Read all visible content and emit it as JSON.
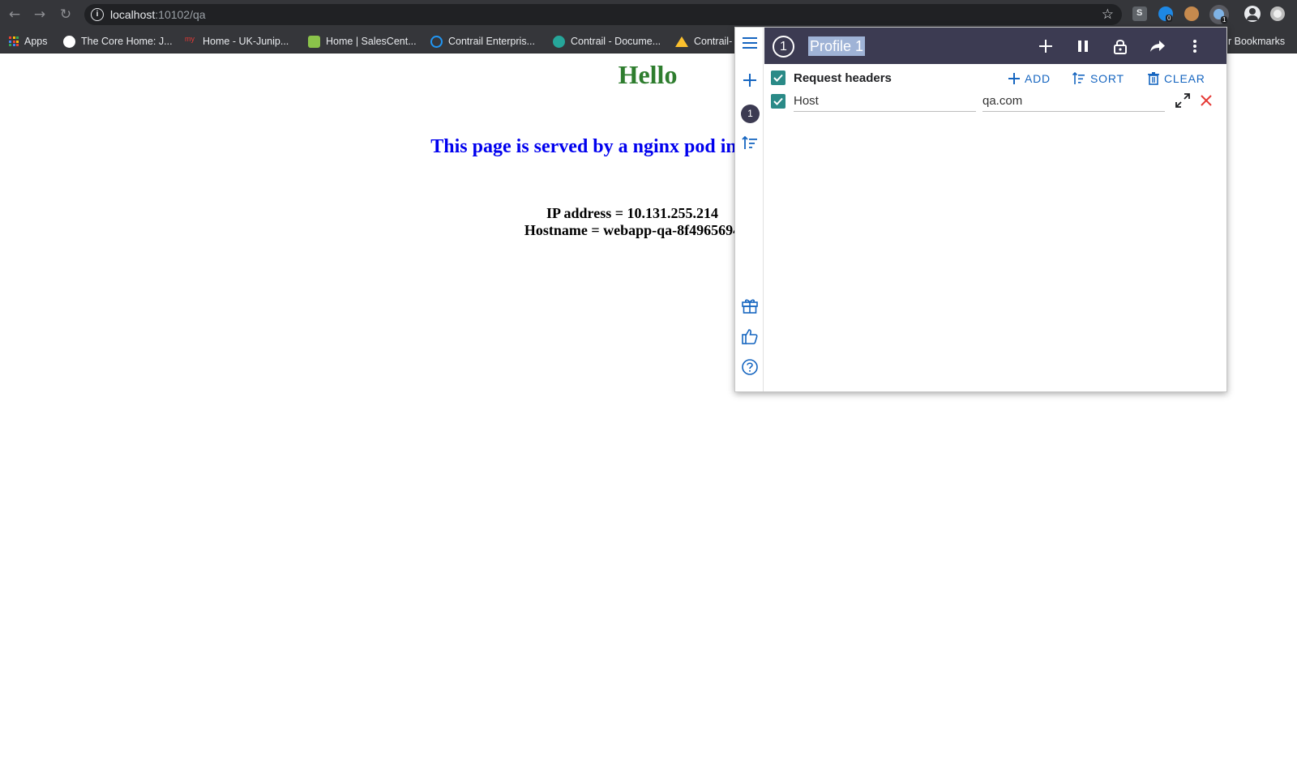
{
  "browser": {
    "url_host": "localhost",
    "url_path": ":10102/qa",
    "bookmarks": [
      {
        "label": "Apps",
        "color": "#e8eaed"
      },
      {
        "label": "The Core Home: J...",
        "color": "#ffffff"
      },
      {
        "label": "Home - UK-Junip...",
        "color": "#e53935"
      },
      {
        "label": "Home | SalesCent...",
        "color": "#8bc34a"
      },
      {
        "label": "Contrail Enterpris...",
        "color": "#2196f3"
      },
      {
        "label": "Contrail - Docume...",
        "color": "#26a69a"
      },
      {
        "label": "Contrail-",
        "color": "#fbc02d"
      }
    ],
    "other_bookmarks": "r Bookmarks",
    "extension_badges": {
      "left": "0",
      "right": "1"
    }
  },
  "page": {
    "hello": "Hello",
    "served": "This page is served by a nginx pod in",
    "ip": "IP address = 10.131.255.214",
    "hostname": "Hostname = webapp-qa-8f4965694"
  },
  "modheader": {
    "profile_number": "1",
    "profile_name": "Profile 1",
    "section_title": "Request headers",
    "actions": {
      "add": "ADD",
      "sort": "SORT",
      "clear": "CLEAR"
    },
    "headers": [
      {
        "name": "Host",
        "value": "qa.com",
        "enabled": true
      }
    ],
    "colors": {
      "header_bg": "#3c3b52",
      "accent": "#1565c0",
      "checkbox": "#2a8a87",
      "delete": "#e53935"
    }
  }
}
